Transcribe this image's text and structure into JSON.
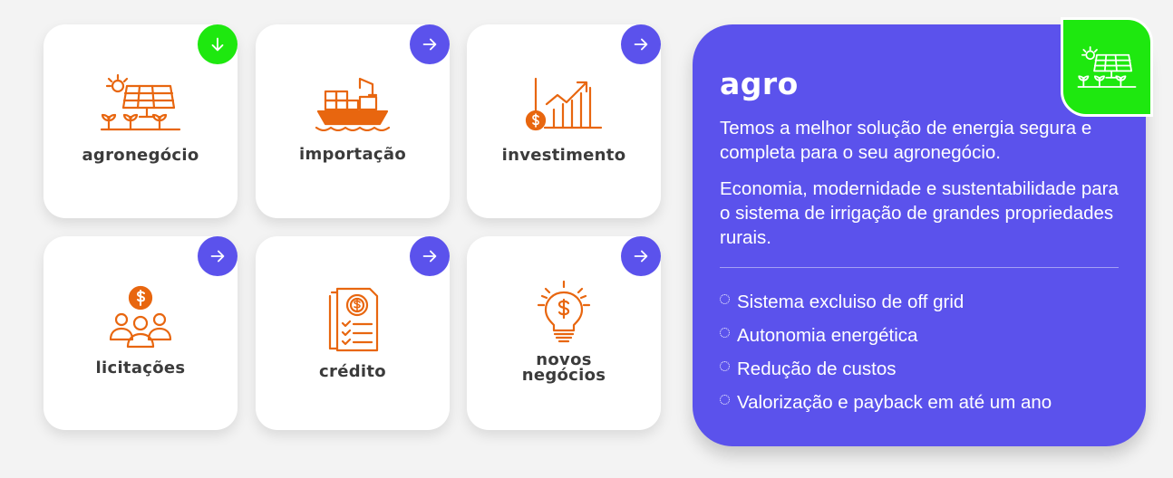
{
  "colors": {
    "accent": "#5b52ec",
    "active": "#1ee80f",
    "icon": "#e8660f",
    "background": "#f3f3f3"
  },
  "cards": [
    {
      "label": "agronegócio",
      "icon": "solar-farm-icon",
      "arrow": "arrow-down-icon",
      "active": true
    },
    {
      "label": "importação",
      "icon": "cargo-ship-icon",
      "arrow": "arrow-right-icon",
      "active": false
    },
    {
      "label": "investimento",
      "icon": "investment-chart-icon",
      "arrow": "arrow-right-icon",
      "active": false
    },
    {
      "label": "licitações",
      "icon": "people-dollar-icon",
      "arrow": "arrow-right-icon",
      "active": false
    },
    {
      "label": "crédito",
      "icon": "credit-document-icon",
      "arrow": "arrow-right-icon",
      "active": false
    },
    {
      "label_line1": "novos",
      "label_line2": "negócios",
      "icon": "lightbulb-dollar-icon",
      "arrow": "arrow-right-icon",
      "active": false
    }
  ],
  "panel": {
    "title": "agro",
    "badge_icon": "solar-farm-icon",
    "paragraphs": [
      "Temos a melhor solução de energia segura e completa para o seu agronegócio.",
      "Economia, modernidade e sustentabilidade para o sistema de irrigação de grandes propriedades rurais."
    ],
    "features": [
      "Sistema excluiso de off grid",
      "Autonomia energética",
      "Redução de custos",
      "Valorização e payback em até um ano"
    ]
  }
}
